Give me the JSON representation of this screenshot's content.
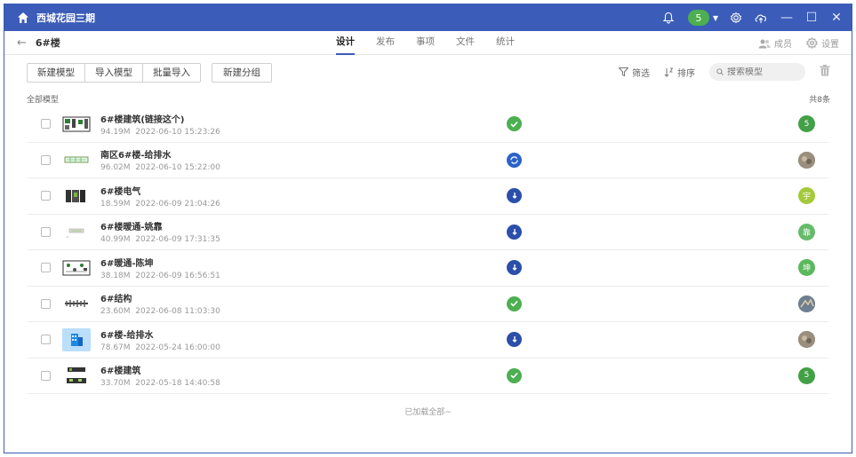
{
  "titlebar": {
    "project_name": "西城花园三期",
    "notification_count": "5"
  },
  "breadcrumb": {
    "current": "6#楼"
  },
  "tabs": [
    {
      "label": "设计",
      "active": true
    },
    {
      "label": "发布",
      "active": false
    },
    {
      "label": "事项",
      "active": false
    },
    {
      "label": "文件",
      "active": false
    },
    {
      "label": "统计",
      "active": false
    }
  ],
  "header_right": {
    "members_label": "成员",
    "settings_label": "设置"
  },
  "actions": {
    "new_model": "新建模型",
    "import_model": "导入模型",
    "batch_import": "批量导入",
    "new_group": "新建分组"
  },
  "filters": {
    "filter_label": "筛选",
    "sort_label": "排序",
    "search_placeholder": "搜索模型"
  },
  "list": {
    "title": "全部模型",
    "count_label": "共8条",
    "footer": "已加载全部~",
    "items": [
      {
        "name": "6#楼建筑(链接这个)",
        "size": "94.19M",
        "date": "2022-06-10 15:23:26",
        "status": "ok",
        "avatar_text": "5",
        "avatar_color": "#43a047"
      },
      {
        "name": "南区6#楼-给排水",
        "size": "96.02M",
        "date": "2022-06-10 15:22:00",
        "status": "sync",
        "avatar_text": "",
        "avatar_color": "#8a8070"
      },
      {
        "name": "6#楼电气",
        "size": "18.59M",
        "date": "2022-06-09 21:04:26",
        "status": "down",
        "avatar_text": "宇",
        "avatar_color": "#a4c93a"
      },
      {
        "name": "6#楼暖通-姚靠",
        "size": "40.99M",
        "date": "2022-06-09 17:31:35",
        "status": "down",
        "avatar_text": "靠",
        "avatar_color": "#66bb6a"
      },
      {
        "name": "6#暖通-陈坤",
        "size": "38.18M",
        "date": "2022-06-09 16:56:51",
        "status": "down",
        "avatar_text": "坤",
        "avatar_color": "#5cb85c"
      },
      {
        "name": "6#结构",
        "size": "23.60M",
        "date": "2022-06-08 11:03:30",
        "status": "ok",
        "avatar_text": "",
        "avatar_color": "#7a8a9a"
      },
      {
        "name": "6#楼-给排水",
        "size": "78.67M",
        "date": "2022-05-24 16:00:00",
        "status": "down",
        "avatar_text": "",
        "avatar_color": "#8a8070"
      },
      {
        "name": "6#楼建筑",
        "size": "33.70M",
        "date": "2022-05-18 14:40:58",
        "status": "ok",
        "avatar_text": "5",
        "avatar_color": "#43a047"
      }
    ]
  },
  "colors": {
    "brand": "#3b5cb8",
    "ok": "#4caf50",
    "sync": "#2b63c8",
    "down": "#2b4faa"
  }
}
